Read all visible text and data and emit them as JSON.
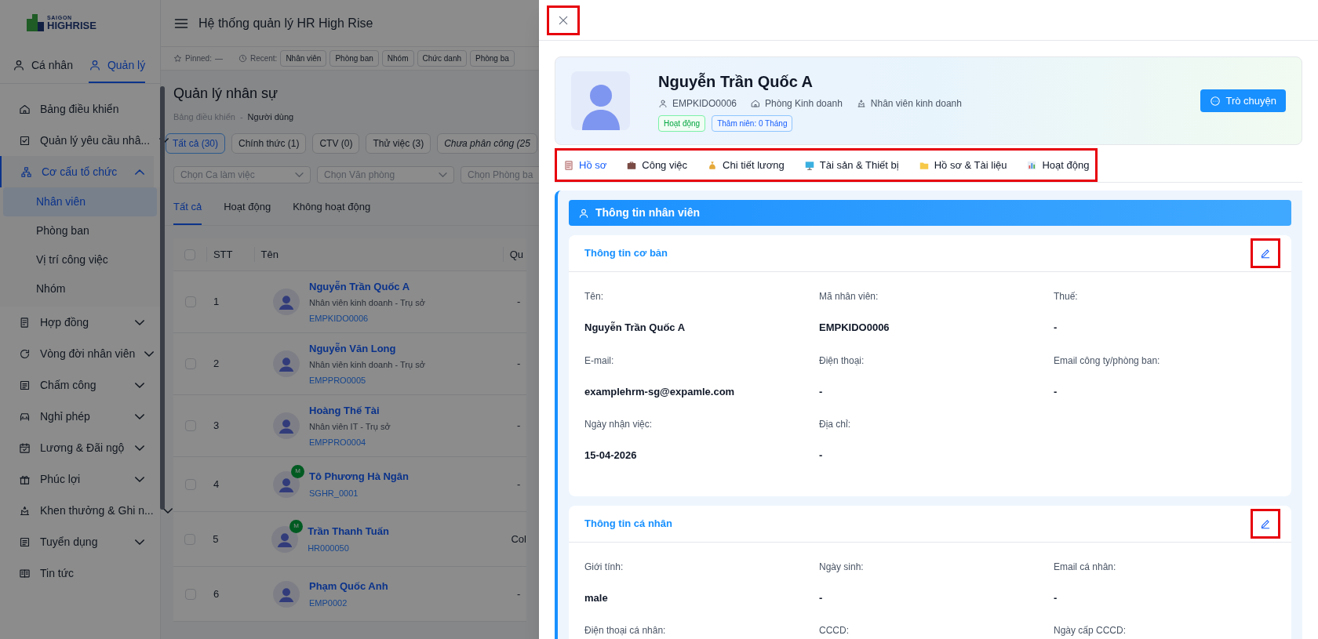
{
  "sidebar": {
    "logo": {
      "line_1": "SAIGON",
      "line_2": "HIGHRISE"
    },
    "mode_tabs": [
      {
        "label": "Cá nhân",
        "selected": false
      },
      {
        "label": "Quản lý",
        "selected": true
      }
    ],
    "menu": [
      {
        "label": "Bảng điều khiển",
        "kind": "link",
        "selected": false
      },
      {
        "label": "Quản lý yêu cầu nhâ...",
        "kind": "group",
        "expanded": false,
        "selected": false
      },
      {
        "label": "Cơ cấu tổ chức",
        "kind": "group",
        "expanded": true,
        "selected": true,
        "children": [
          {
            "label": "Nhân viên",
            "selected": true
          },
          {
            "label": "Phòng ban",
            "selected": false
          },
          {
            "label": "Vị trí công việc",
            "selected": false
          },
          {
            "label": "Nhóm",
            "selected": false
          }
        ]
      },
      {
        "label": "Hợp đồng",
        "kind": "group",
        "expanded": false,
        "selected": false
      },
      {
        "label": "Vòng đời nhân viên",
        "kind": "group",
        "expanded": false,
        "selected": false
      },
      {
        "label": "Chấm công",
        "kind": "group",
        "expanded": false,
        "selected": false
      },
      {
        "label": "Nghỉ phép",
        "kind": "group",
        "expanded": false,
        "selected": false
      },
      {
        "label": "Lương & Đãi ngộ",
        "kind": "group",
        "expanded": false,
        "selected": false
      },
      {
        "label": "Phúc lợi",
        "kind": "group",
        "expanded": false,
        "selected": false
      },
      {
        "label": "Khen thưởng & Ghi n...",
        "kind": "group",
        "expanded": false,
        "selected": false
      },
      {
        "label": "Tuyển dụng",
        "kind": "group",
        "expanded": false,
        "selected": false
      },
      {
        "label": "Tin tức",
        "kind": "link",
        "selected": false
      }
    ]
  },
  "header": {
    "title": "Hệ thống quản lý HR High Rise"
  },
  "quick_bar": {
    "pinned_label": "Pinned:",
    "pinned_value": "—",
    "recent_label": "Recent:",
    "recent": [
      "Nhân viên",
      "Phòng ban",
      "Nhóm",
      "Chức danh",
      "Phòng ba"
    ]
  },
  "page": {
    "title": "Quản lý nhân sự",
    "breadcrumb": [
      "Bảng điều khiển",
      "Người dùng"
    ],
    "breadcrumb_separator": "-",
    "filter_chips": [
      {
        "label": "Tất cả (30)",
        "selected": true
      },
      {
        "label": "Chính thức (1)",
        "selected": false
      },
      {
        "label": "CTV (0)",
        "selected": false
      },
      {
        "label": "Thử việc (3)",
        "selected": false
      },
      {
        "label": "Chưa phân công (25",
        "selected": false
      }
    ],
    "selects": [
      {
        "placeholder": "Chọn Ca làm việc"
      },
      {
        "placeholder": "Chọn Văn phòng"
      },
      {
        "placeholder": "Chọn Phòng ba"
      }
    ],
    "status_tabs": [
      {
        "label": "Tất cả",
        "selected": true
      },
      {
        "label": "Hoạt động",
        "selected": false
      },
      {
        "label": "Không hoạt động",
        "selected": false
      }
    ]
  },
  "table": {
    "columns": [
      "STT",
      "Tên",
      "Qu"
    ],
    "all_checked": false,
    "rows": [
      {
        "index": "1",
        "name": "Nguyễn Trần Quốc A",
        "position": "Nhân viên kinh doanh - Trụ sở",
        "code": "EMPKIDO0006",
        "badge": null,
        "column_3": "-",
        "checked": false
      },
      {
        "index": "2",
        "name": "Nguyễn Văn Long",
        "position": "Nhân viên kinh doanh - Trụ sở",
        "code": "EMPPRO0005",
        "badge": null,
        "column_3": "-",
        "checked": false
      },
      {
        "index": "3",
        "name": "Hoàng Thế Tài",
        "position": "Nhân viên IT - Trụ sở",
        "code": "EMPPRO0004",
        "badge": null,
        "column_3": "-",
        "checked": false
      },
      {
        "index": "4",
        "name": "Tô Phương Hà Ngân",
        "position": null,
        "code": "SGHR_0001",
        "badge": "M",
        "column_3": "-",
        "checked": false
      },
      {
        "index": "5",
        "name": "Trần Thanh Tuấn",
        "position": null,
        "code": "HR000050",
        "badge": "M",
        "column_3": "Col",
        "checked": false
      },
      {
        "index": "6",
        "name": "Phạm Quốc Anh",
        "position": null,
        "code": "EMP0002",
        "badge": null,
        "column_3": "-",
        "checked": false
      }
    ]
  },
  "drawer": {
    "close_button": {
      "highlighted": true
    },
    "profile": {
      "name": "Nguyễn Trần Quốc A",
      "code": "EMPKIDO0006",
      "department": "Phòng Kinh doanh",
      "position": "Nhân viên kinh doanh",
      "badges": [
        {
          "label": "Hoạt động",
          "kind": "status"
        },
        {
          "label": "Thâm niên: 0 Tháng",
          "kind": "tenure"
        }
      ],
      "chat_button": "Trò chuyện"
    },
    "tabs": {
      "highlighted": true,
      "items": [
        {
          "label": "Hồ sơ",
          "selected": true
        },
        {
          "label": "Công việc",
          "selected": false
        },
        {
          "label": "Chi tiết lương",
          "selected": false
        },
        {
          "label": "Tài sản & Thiết bị",
          "selected": false
        },
        {
          "label": "Hồ sơ & Tài liệu",
          "selected": false
        },
        {
          "label": "Hoạt động",
          "selected": false
        }
      ]
    },
    "section_title": "Thông tin nhân viên",
    "cards": [
      {
        "title": "Thông tin cơ bản",
        "edit_highlighted": true,
        "fields": [
          {
            "label": "Tên:",
            "value": "Nguyễn Trần Quốc A"
          },
          {
            "label": "Mã nhân viên:",
            "value": "EMPKIDO0006"
          },
          {
            "label": "Thuế:",
            "value": "-"
          },
          {
            "label": "E-mail:",
            "value": "examplehrm-sg@expamle.com"
          },
          {
            "label": "Điện thoại:",
            "value": "-"
          },
          {
            "label": "Email công ty/phòng ban:",
            "value": "-"
          },
          {
            "label": "Ngày nhận việc:",
            "value": "15-04-2026"
          },
          {
            "label": "Địa chỉ:",
            "value": "-"
          }
        ]
      },
      {
        "title": "Thông tin cá nhân",
        "edit_highlighted": true,
        "fields": [
          {
            "label": "Giới tính:",
            "value": "male"
          },
          {
            "label": "Ngày sinh:",
            "value": "-"
          },
          {
            "label": "Email cá nhân:",
            "value": "-"
          },
          {
            "label": "Điện thoại cá nhân:"
          },
          {
            "label": "CCCD:"
          },
          {
            "label": "Ngày cấp CCCD:"
          }
        ]
      }
    ]
  }
}
